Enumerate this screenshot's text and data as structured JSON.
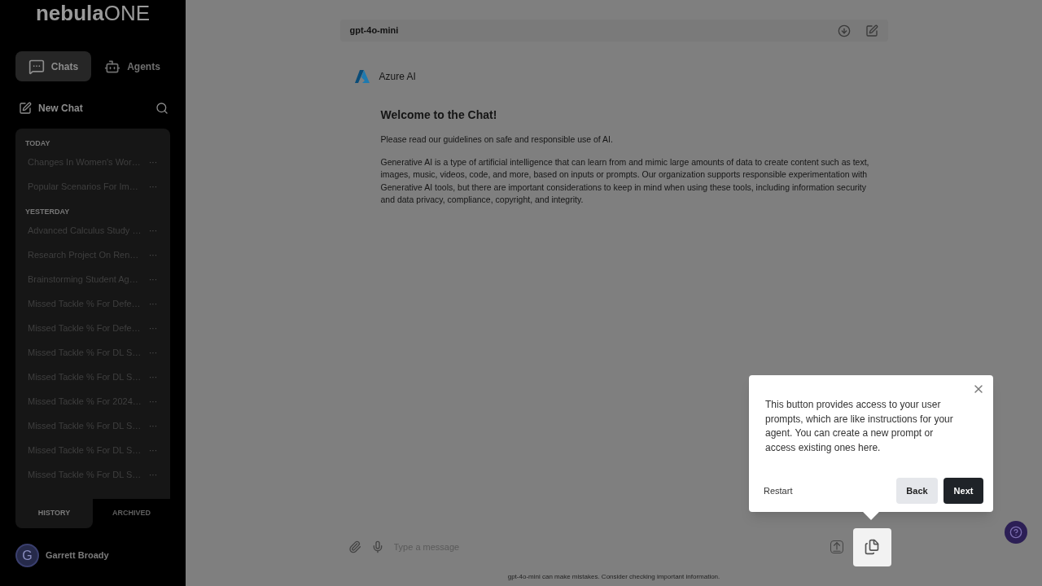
{
  "sidebar": {
    "logo": {
      "main": "nebula",
      "accent": "ONE"
    },
    "tabs": [
      {
        "label": "Chats",
        "selected": true
      },
      {
        "label": "Agents",
        "selected": false
      }
    ],
    "new_chat": "New Chat",
    "groups": [
      {
        "heading": "TODAY",
        "items": [
          "Changes In Women's Wor…",
          "Popular Scenarios For Im…"
        ]
      },
      {
        "heading": "YESTERDAY",
        "items": [
          "Advanced Calculus Study …",
          "Research Project On Ren…",
          "Brainstorming Student Ag…",
          "Missed Tackle % For Defe…",
          "Missed Tackle % For Defe…",
          "Missed Tackle % For DL S…",
          "Missed Tackle % For DL S…",
          "Missed Tackle % For 2024…",
          "Missed Tackle % For DL S…",
          "Missed Tackle % For DL S…",
          "Missed Tackle % For DL S…"
        ]
      }
    ],
    "item_menu": "···",
    "list_tabs": [
      {
        "label": "HISTORY",
        "selected": true
      },
      {
        "label": "ARCHIVED",
        "selected": false
      }
    ],
    "user": {
      "initial": "G",
      "name": "Garrett Broady"
    }
  },
  "chat": {
    "model": "gpt-4o-mini",
    "assistant": "Azure AI",
    "title": "Welcome to the Chat!",
    "paragraphs": [
      "Please read our guidelines on safe and responsible use of AI.",
      "Generative AI is a type of artificial intelligence that can learn from and mimic large amounts of data to create content such as text, images, music, videos, code, and more, based on inputs or prompts. Our organization supports responsible experimentation with Generative AI tools, but there are important considerations to keep in mind when using these tools, including information security and data privacy, compliance, copyright, and integrity."
    ],
    "input": {
      "placeholder": "Type a message"
    },
    "disclaimer": "gpt-4o-mini can make mistakes. Consider checking important information."
  },
  "tour": {
    "text": "This button provides access to your user prompts, which are like instructions for your agent. You can create a new prompt or access existing ones here.",
    "restart": "Restart",
    "back": "Back",
    "next": "Next"
  }
}
